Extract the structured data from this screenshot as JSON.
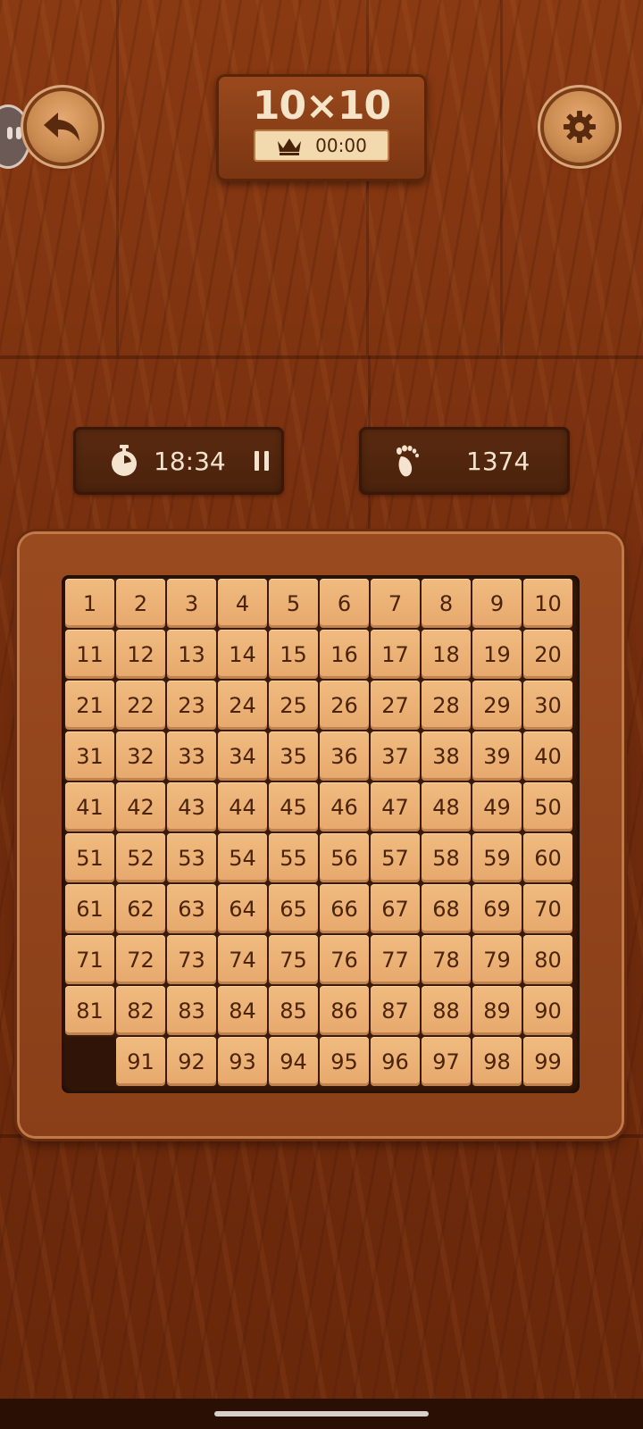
{
  "header": {
    "title": "10×10",
    "best_time": "00:00"
  },
  "stats": {
    "timer": "18:34",
    "moves": "1374"
  },
  "board": {
    "size": 10,
    "tiles": [
      1,
      2,
      3,
      4,
      5,
      6,
      7,
      8,
      9,
      10,
      11,
      12,
      13,
      14,
      15,
      16,
      17,
      18,
      19,
      20,
      21,
      22,
      23,
      24,
      25,
      26,
      27,
      28,
      29,
      30,
      31,
      32,
      33,
      34,
      35,
      36,
      37,
      38,
      39,
      40,
      41,
      42,
      43,
      44,
      45,
      46,
      47,
      48,
      49,
      50,
      51,
      52,
      53,
      54,
      55,
      56,
      57,
      58,
      59,
      60,
      61,
      62,
      63,
      64,
      65,
      66,
      67,
      68,
      69,
      70,
      71,
      72,
      73,
      74,
      75,
      76,
      77,
      78,
      79,
      80,
      81,
      82,
      83,
      84,
      85,
      86,
      87,
      88,
      89,
      90,
      null,
      91,
      92,
      93,
      94,
      95,
      96,
      97,
      98,
      99
    ]
  },
  "icons": {
    "back": "back-arrow-icon",
    "settings": "gear-icon",
    "best": "crown-icon",
    "timer": "stopwatch-icon",
    "pause": "pause-icon",
    "moves": "footprint-icon"
  }
}
